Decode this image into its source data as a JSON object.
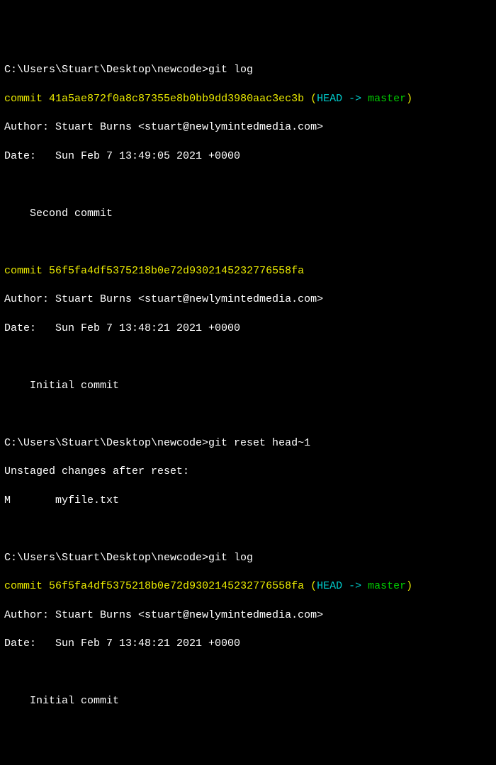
{
  "prompt_path": "C:\\Users\\Stuart\\Desktop\\newcode>",
  "commands": {
    "git_log": "git log",
    "git_reset": "git reset head~1"
  },
  "commits": {
    "c1": {
      "commit_word": "commit",
      "hash": "41a5ae872f0a8c87355e8b0bb9dd3980aac3ec3b",
      "ref_open": " (",
      "head": "HEAD -> ",
      "branch": "master",
      "ref_close": ")",
      "author_line": "Author: Stuart Burns <stuart@newlymintedmedia.com>",
      "date_line": "Date:   Sun Feb 7 13:49:05 2021 +0000",
      "message": "    Second commit"
    },
    "c2": {
      "commit_word": "commit",
      "hash": "56f5fa4df5375218b0e72d9302145232776558fa",
      "author_line": "Author: Stuart Burns <stuart@newlymintedmedia.com>",
      "date_line": "Date:   Sun Feb 7 13:48:21 2021 +0000",
      "message": "    Initial commit"
    },
    "c3": {
      "commit_word": "commit",
      "hash": "56f5fa4df5375218b0e72d9302145232776558fa",
      "ref_open": " (",
      "head": "HEAD -> ",
      "branch": "master",
      "ref_close": ")",
      "author_line": "Author: Stuart Burns <stuart@newlymintedmedia.com>",
      "date_line": "Date:   Sun Feb 7 13:48:21 2021 +0000",
      "message": "    Initial commit"
    }
  },
  "reset_output": {
    "line1": "Unstaged changes after reset:",
    "line2": "M       myfile.txt"
  }
}
